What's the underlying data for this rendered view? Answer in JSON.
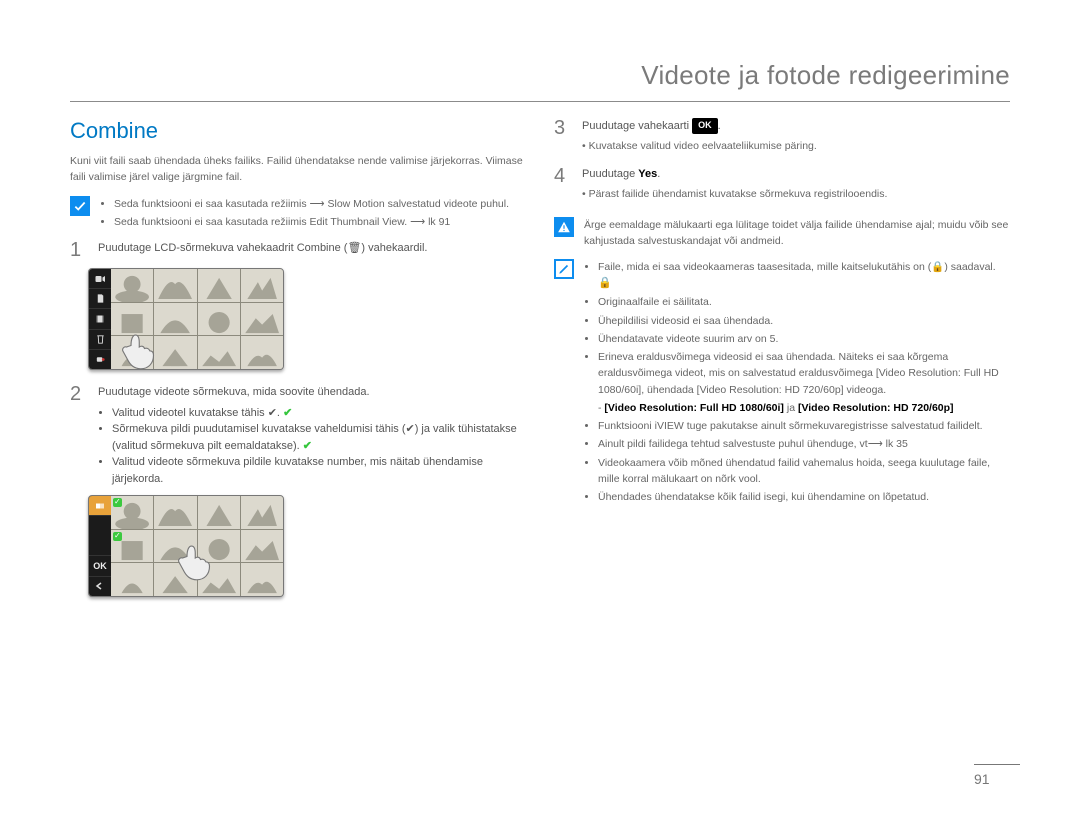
{
  "header": {
    "title": "Videote ja fotode redigeerimine"
  },
  "section": {
    "title": "Combine"
  },
  "intro": "Kuni viit faili saab ühendada üheks failiks. Failid ühendatakse nende valimise järjekorras. Viimase faili valimise järel valige järgmine fail.",
  "tip1": {
    "line1": "Seda funktsiooni ei saa kasutada režiimis ⟶ Slow Motion salvestatud videote puhul.",
    "line2": "Seda funktsiooni ei saa kasutada režiimis Edit Thumbnail View. ⟶ lk 91"
  },
  "step1": {
    "text": "Puudutage LCD-sõrmekuva vahekaadrit Combine (🗑) vahekaardil.",
    "trash": "🗑"
  },
  "step2": {
    "text": "Puudutage videote sõrmekuva, mida soovite ühendada.",
    "bullets": [
      "Valitud videotel kuvatakse tähis ✔.",
      "Sõrmekuva pildi puudutamisel kuvatakse vaheldumisi tähis (✔) ja valik tühistatakse (valitud sõrmekuva pilt eemaldatakse).",
      "Valitud videote sõrmekuva pildile kuvatakse number, mis näitab ühendamise järjekorda."
    ]
  },
  "step3": {
    "text_before": "Puudutage vahekaarti",
    "ok": "OK",
    "text_after": ".",
    "sub": "Kuvatakse valitud video eelvaateliikumise päring."
  },
  "step4": {
    "text_before": "Puudutage",
    "yes": "Yes",
    "text_after": ".",
    "sub": "Pärast failide ühendamist kuvatakse sõrmekuva registrilooendis."
  },
  "warn": {
    "items": [
      "Ärge eemaldage mälukaarti ega lülitage toidet välja failide ühendamise ajal; muidu võib see kahjustada salvestuskandajat või andmeid."
    ]
  },
  "notes2": {
    "items": [
      "Faile, mida ei saa videokaameras taasesitada, mille kaitselukutähis on (🔒) saadaval.",
      "Originaalfaile ei säilitata.",
      "Ühepildilisi videosid ei saa ühendada.",
      "Ühendatavate videote suurim arv on 5.",
      "Erineva eraldusvõimega videosid ei saa ühendada. Näiteks ei saa kõrgema eraldusvõimega videot, mis on salvestatud eraldusvõimega [Video Resolution: Full HD 1080/60i], ühendada [Video Resolution: HD 720/60p] videoga.",
      "Funktsiooni iVIEW tuge pakutakse ainult sõrmekuvaregistrisse salvestatud failidelt.",
      "Ainult pildi failidega tehtud salvestuste puhul ühenduge, vt⟶ lk 35",
      "Videokaamera võib mõned ühendatud failid vahemalus hoida, seega kuulutage faile, mille korral mälukaart on nõrk vool.",
      "Ühendades ühendatakse kõik failid isegi, kui ühendamine on lõpetatud."
    ],
    "res_a": "[Video Resolution: Full HD 1080/60i]",
    "res_b": "[Video Resolution: HD 720/60p]"
  },
  "pagenum": "91",
  "icons": {
    "check": "✔",
    "lock": "🔒",
    "trash": "🗑",
    "arrow": "⟶"
  }
}
